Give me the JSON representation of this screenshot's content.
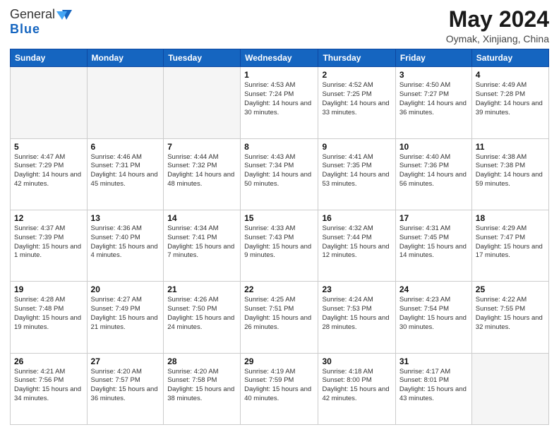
{
  "header": {
    "logo_general": "General",
    "logo_blue": "Blue",
    "month_title": "May 2024",
    "location": "Oymak, Xinjiang, China"
  },
  "weekdays": [
    "Sunday",
    "Monday",
    "Tuesday",
    "Wednesday",
    "Thursday",
    "Friday",
    "Saturday"
  ],
  "weeks": [
    [
      {
        "day": "",
        "info": ""
      },
      {
        "day": "",
        "info": ""
      },
      {
        "day": "",
        "info": ""
      },
      {
        "day": "1",
        "info": "Sunrise: 4:53 AM\nSunset: 7:24 PM\nDaylight: 14 hours\nand 30 minutes."
      },
      {
        "day": "2",
        "info": "Sunrise: 4:52 AM\nSunset: 7:25 PM\nDaylight: 14 hours\nand 33 minutes."
      },
      {
        "day": "3",
        "info": "Sunrise: 4:50 AM\nSunset: 7:27 PM\nDaylight: 14 hours\nand 36 minutes."
      },
      {
        "day": "4",
        "info": "Sunrise: 4:49 AM\nSunset: 7:28 PM\nDaylight: 14 hours\nand 39 minutes."
      }
    ],
    [
      {
        "day": "5",
        "info": "Sunrise: 4:47 AM\nSunset: 7:29 PM\nDaylight: 14 hours\nand 42 minutes."
      },
      {
        "day": "6",
        "info": "Sunrise: 4:46 AM\nSunset: 7:31 PM\nDaylight: 14 hours\nand 45 minutes."
      },
      {
        "day": "7",
        "info": "Sunrise: 4:44 AM\nSunset: 7:32 PM\nDaylight: 14 hours\nand 48 minutes."
      },
      {
        "day": "8",
        "info": "Sunrise: 4:43 AM\nSunset: 7:34 PM\nDaylight: 14 hours\nand 50 minutes."
      },
      {
        "day": "9",
        "info": "Sunrise: 4:41 AM\nSunset: 7:35 PM\nDaylight: 14 hours\nand 53 minutes."
      },
      {
        "day": "10",
        "info": "Sunrise: 4:40 AM\nSunset: 7:36 PM\nDaylight: 14 hours\nand 56 minutes."
      },
      {
        "day": "11",
        "info": "Sunrise: 4:38 AM\nSunset: 7:38 PM\nDaylight: 14 hours\nand 59 minutes."
      }
    ],
    [
      {
        "day": "12",
        "info": "Sunrise: 4:37 AM\nSunset: 7:39 PM\nDaylight: 15 hours\nand 1 minute."
      },
      {
        "day": "13",
        "info": "Sunrise: 4:36 AM\nSunset: 7:40 PM\nDaylight: 15 hours\nand 4 minutes."
      },
      {
        "day": "14",
        "info": "Sunrise: 4:34 AM\nSunset: 7:41 PM\nDaylight: 15 hours\nand 7 minutes."
      },
      {
        "day": "15",
        "info": "Sunrise: 4:33 AM\nSunset: 7:43 PM\nDaylight: 15 hours\nand 9 minutes."
      },
      {
        "day": "16",
        "info": "Sunrise: 4:32 AM\nSunset: 7:44 PM\nDaylight: 15 hours\nand 12 minutes."
      },
      {
        "day": "17",
        "info": "Sunrise: 4:31 AM\nSunset: 7:45 PM\nDaylight: 15 hours\nand 14 minutes."
      },
      {
        "day": "18",
        "info": "Sunrise: 4:29 AM\nSunset: 7:47 PM\nDaylight: 15 hours\nand 17 minutes."
      }
    ],
    [
      {
        "day": "19",
        "info": "Sunrise: 4:28 AM\nSunset: 7:48 PM\nDaylight: 15 hours\nand 19 minutes."
      },
      {
        "day": "20",
        "info": "Sunrise: 4:27 AM\nSunset: 7:49 PM\nDaylight: 15 hours\nand 21 minutes."
      },
      {
        "day": "21",
        "info": "Sunrise: 4:26 AM\nSunset: 7:50 PM\nDaylight: 15 hours\nand 24 minutes."
      },
      {
        "day": "22",
        "info": "Sunrise: 4:25 AM\nSunset: 7:51 PM\nDaylight: 15 hours\nand 26 minutes."
      },
      {
        "day": "23",
        "info": "Sunrise: 4:24 AM\nSunset: 7:53 PM\nDaylight: 15 hours\nand 28 minutes."
      },
      {
        "day": "24",
        "info": "Sunrise: 4:23 AM\nSunset: 7:54 PM\nDaylight: 15 hours\nand 30 minutes."
      },
      {
        "day": "25",
        "info": "Sunrise: 4:22 AM\nSunset: 7:55 PM\nDaylight: 15 hours\nand 32 minutes."
      }
    ],
    [
      {
        "day": "26",
        "info": "Sunrise: 4:21 AM\nSunset: 7:56 PM\nDaylight: 15 hours\nand 34 minutes."
      },
      {
        "day": "27",
        "info": "Sunrise: 4:20 AM\nSunset: 7:57 PM\nDaylight: 15 hours\nand 36 minutes."
      },
      {
        "day": "28",
        "info": "Sunrise: 4:20 AM\nSunset: 7:58 PM\nDaylight: 15 hours\nand 38 minutes."
      },
      {
        "day": "29",
        "info": "Sunrise: 4:19 AM\nSunset: 7:59 PM\nDaylight: 15 hours\nand 40 minutes."
      },
      {
        "day": "30",
        "info": "Sunrise: 4:18 AM\nSunset: 8:00 PM\nDaylight: 15 hours\nand 42 minutes."
      },
      {
        "day": "31",
        "info": "Sunrise: 4:17 AM\nSunset: 8:01 PM\nDaylight: 15 hours\nand 43 minutes."
      },
      {
        "day": "",
        "info": ""
      }
    ]
  ]
}
